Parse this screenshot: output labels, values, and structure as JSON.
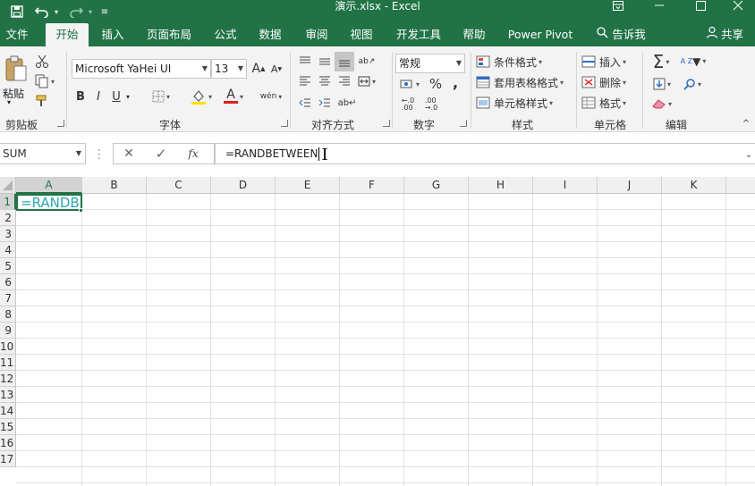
{
  "window": {
    "title": "演示.xlsx  -  Excel",
    "controls": [
      "ribbon-display-icon",
      "minimize-icon",
      "restore-icon",
      "close-icon"
    ]
  },
  "quick_access": [
    "save-icon",
    "undo-icon",
    "redo-icon",
    "customize-icon"
  ],
  "tabs": [
    {
      "label": "文件"
    },
    {
      "label": "开始",
      "active": true
    },
    {
      "label": "插入"
    },
    {
      "label": "页面布局"
    },
    {
      "label": "公式"
    },
    {
      "label": "数据"
    },
    {
      "label": "审阅"
    },
    {
      "label": "视图"
    },
    {
      "label": "开发工具"
    },
    {
      "label": "帮助"
    },
    {
      "label": "Power Pivot"
    }
  ],
  "tellme": "告诉我",
  "share": "共享",
  "ribbon": {
    "clipboard": {
      "label": "剪贴板",
      "paste": "粘贴"
    },
    "font": {
      "label": "字体",
      "font_name": "Microsoft YaHei UI",
      "font_size": "13",
      "bold": "B",
      "italic": "I",
      "underline": "U",
      "grow": "A",
      "shrink": "A",
      "font_color_letter": "A",
      "phonetic": "wén"
    },
    "alignment": {
      "label": "对齐方式"
    },
    "number": {
      "label": "数字",
      "format": "常规",
      "percent": "%",
      "comma": ","
    },
    "styles": {
      "label": "样式",
      "conditional": "条件格式",
      "table": "套用表格格式",
      "cell_styles": "单元格样式"
    },
    "cells": {
      "label": "单元格",
      "insert": "插入",
      "delete": "删除",
      "format": "格式"
    },
    "editing": {
      "label": "编辑",
      "sum": "Σ",
      "sort": "A Z"
    }
  },
  "formula_bar": {
    "name_box": "SUM",
    "fx": "fx",
    "formula": "=RANDBETWEEN"
  },
  "sheet": {
    "columns": [
      "A",
      "B",
      "C",
      "D",
      "E",
      "F",
      "G",
      "H",
      "I",
      "J",
      "K"
    ],
    "rows": [
      "1",
      "2",
      "3",
      "4",
      "5",
      "6",
      "7",
      "8",
      "9",
      "10",
      "11",
      "12",
      "13",
      "14",
      "15",
      "16",
      "17"
    ],
    "active_cell": "A1",
    "active_cell_text": "=RANDBETWEEN"
  }
}
